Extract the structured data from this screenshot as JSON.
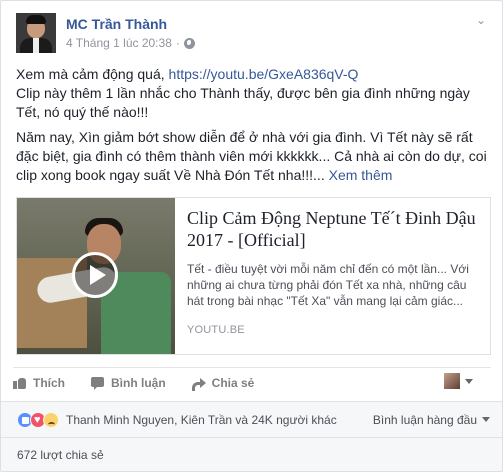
{
  "post": {
    "author": "MC Trần Thành",
    "timestamp": "4 Tháng 1 lúc 20:38",
    "separator": "·",
    "privacy_icon": "globe-icon",
    "more_icon": "chevron-down-icon",
    "text": {
      "line1_prefix": "Xem mà cảm động quá, ",
      "link": "https://youtu.be/GxeA836qV-Q",
      "paragraph1_rest": "Clip này thêm 1 lần nhắc cho Thành thấy, được bên gia đình những ngày Tết, nó quý thế nào!!!",
      "paragraph2": "Năm nay, Xìn giảm bớt show diễn để ở nhà với gia đình. Vì Tết này sẽ rất đặc biệt, gia đình có thêm thành viên mới kkkkkk... Cả nhà ai còn do dự, coi clip xong book ngay suất Về Nhà Đón Tết nha!!!...",
      "see_more": "Xem thêm"
    }
  },
  "link_card": {
    "title": "Clip Cảm Động Neptune Tế´t Đinh Dậu 2017 - [Official]",
    "description": "Tết - điều tuyệt vời mỗi năm chỉ đến có một lần... Với những ai chưa từng phải đón Tết xa nhà, những câu hát trong bài nhạc \"Tết Xa\" vẫn mang lại cảm giác...",
    "domain": "YOUTU.BE"
  },
  "actions": {
    "like": "Thích",
    "comment": "Bình luận",
    "share": "Chia sẻ"
  },
  "reactions": {
    "names": "Thanh Minh Nguyen, Kiên Trần và 24K người khác",
    "ranking": "Bình luận hàng đầu"
  },
  "shares": {
    "count_label": "672 lượt chia sẻ"
  }
}
